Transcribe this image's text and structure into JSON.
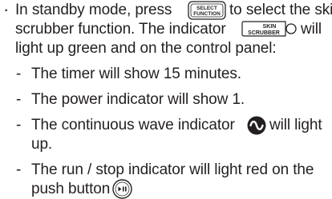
{
  "doc": {
    "bullet": "·",
    "dash": "-",
    "intro": {
      "t1": "In standby mode, press",
      "t2": "to select the skin",
      "t3": "scrubber function. The indicator",
      "t4": "will",
      "t5": "light up green and on the control panel:"
    },
    "button_select": {
      "line1": "SELECT",
      "line2": "FUNCTION"
    },
    "indicator_skin": {
      "line1": "SKIN",
      "line2": "SCRUBBER"
    },
    "items": [
      {
        "text": "The timer will show 15 minutes."
      },
      {
        "text": "The power indicator will show 1."
      },
      {
        "t1": "The continuous wave indicator",
        "t2": "will light",
        "t3": "up."
      },
      {
        "t1": "The run / stop indicator will light red on the",
        "t2": "push button"
      }
    ],
    "icons": {
      "continuous_wave": "continuous-wave-icon",
      "run_stop": "run-stop-button-icon"
    }
  }
}
